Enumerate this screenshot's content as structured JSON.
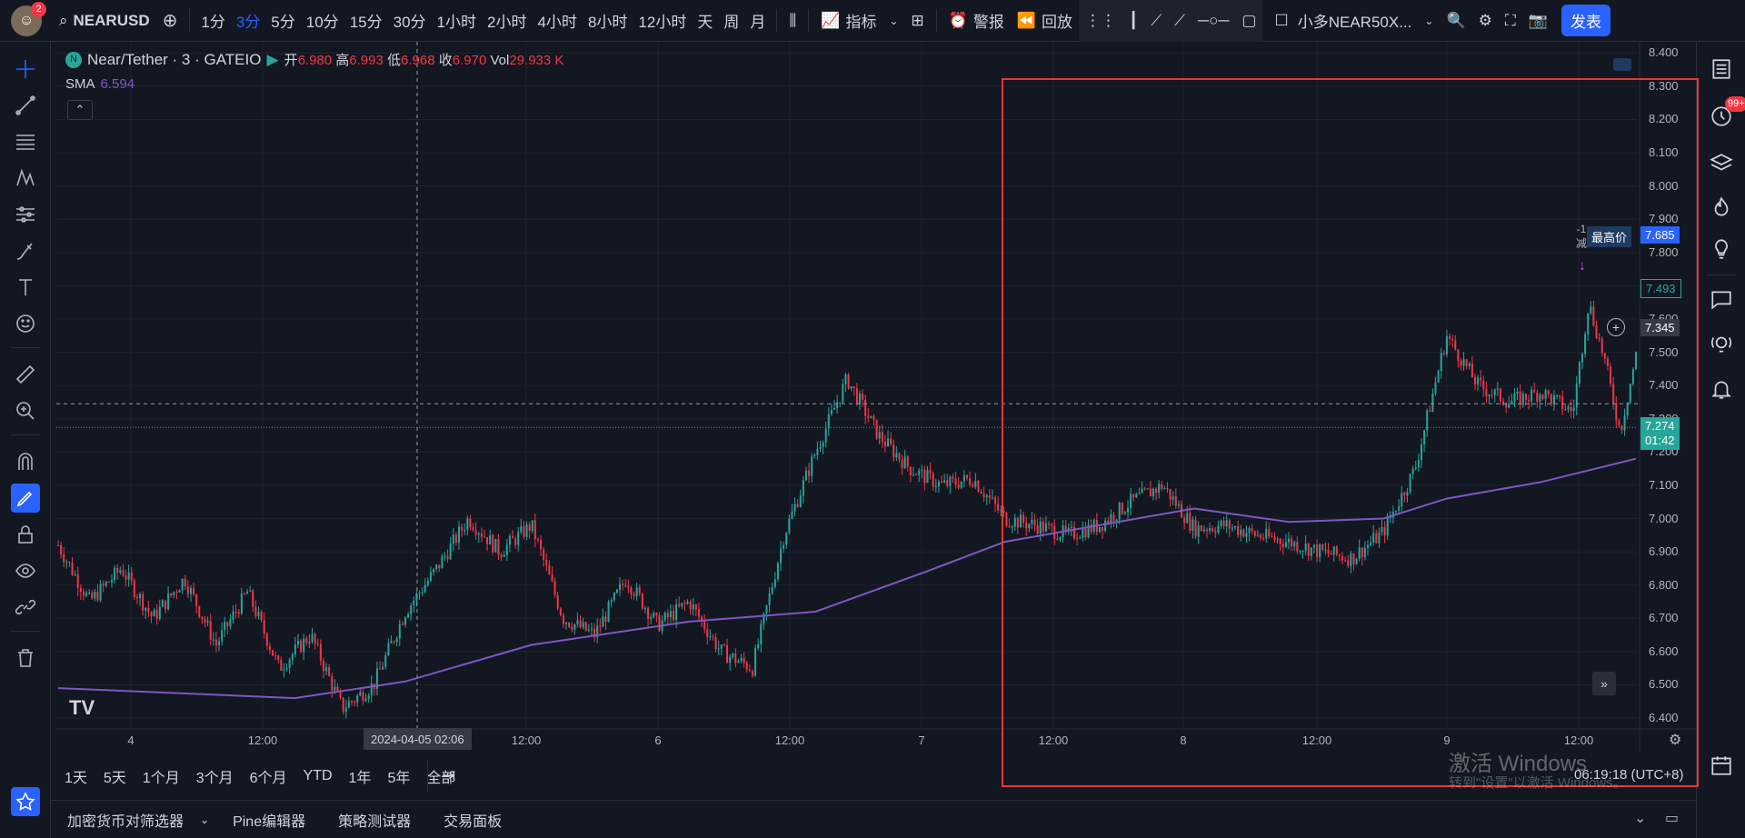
{
  "topbar": {
    "notification_count": "2",
    "symbol": "NEARUSD",
    "intervals": [
      "1分",
      "3分",
      "5分",
      "10分",
      "15分",
      "30分",
      "1小时",
      "2小时",
      "4小时",
      "8小时",
      "12小时",
      "天",
      "周",
      "月"
    ],
    "active_interval": "3分",
    "indicators_label": "指标",
    "alert_label": "警报",
    "replay_label": "回放",
    "layout_name": "小多NEAR50X...",
    "publish_label": "发表"
  },
  "legend": {
    "title": "Near/Tether · 3 · GATEIO",
    "open_label": "开",
    "open": "6.980",
    "high_label": "高",
    "high": "6.993",
    "low_label": "低",
    "low": "6.968",
    "close_label": "收",
    "close": "6.970",
    "vol_label": "Vol",
    "vol": "29.933 K",
    "sma_label": "SMA",
    "sma_value": "6.594"
  },
  "chart_data": {
    "type": "candlestick",
    "price_axis": [
      "8.400",
      "8.300",
      "8.200",
      "8.100",
      "8.000",
      "7.900",
      "7.800",
      "7.700",
      "7.600",
      "7.500",
      "7.400",
      "7.300",
      "7.200",
      "7.100",
      "7.000",
      "6.900",
      "6.800",
      "6.700",
      "6.600",
      "6.500",
      "6.400"
    ],
    "time_axis": [
      "4",
      "12:00",
      "12:00",
      "6",
      "12:00",
      "7",
      "12:00",
      "8",
      "12:00",
      "9",
      "12:00"
    ],
    "crosshair_time": "2024-04-05   02:06",
    "ylim": [
      6.37,
      8.42
    ],
    "price_path": [
      [
        0,
        6.92
      ],
      [
        0.02,
        6.75
      ],
      [
        0.04,
        6.85
      ],
      [
        0.06,
        6.7
      ],
      [
        0.08,
        6.82
      ],
      [
        0.1,
        6.62
      ],
      [
        0.12,
        6.78
      ],
      [
        0.14,
        6.55
      ],
      [
        0.16,
        6.65
      ],
      [
        0.18,
        6.43
      ],
      [
        0.2,
        6.5
      ],
      [
        0.22,
        6.72
      ],
      [
        0.24,
        6.85
      ],
      [
        0.26,
        7.0
      ],
      [
        0.28,
        6.9
      ],
      [
        0.3,
        6.98
      ],
      [
        0.32,
        6.7
      ],
      [
        0.34,
        6.65
      ],
      [
        0.36,
        6.82
      ],
      [
        0.38,
        6.68
      ],
      [
        0.4,
        6.75
      ],
      [
        0.42,
        6.6
      ],
      [
        0.44,
        6.55
      ],
      [
        0.46,
        6.95
      ],
      [
        0.48,
        7.2
      ],
      [
        0.5,
        7.42
      ],
      [
        0.52,
        7.25
      ],
      [
        0.54,
        7.15
      ],
      [
        0.56,
        7.1
      ],
      [
        0.58,
        7.12
      ],
      [
        0.6,
        7.0
      ],
      [
        0.62,
        6.98
      ],
      [
        0.64,
        6.95
      ],
      [
        0.66,
        6.98
      ],
      [
        0.68,
        7.05
      ],
      [
        0.7,
        7.1
      ],
      [
        0.72,
        6.97
      ],
      [
        0.74,
        6.98
      ],
      [
        0.76,
        6.95
      ],
      [
        0.78,
        6.93
      ],
      [
        0.8,
        6.9
      ],
      [
        0.82,
        6.88
      ],
      [
        0.84,
        6.96
      ],
      [
        0.86,
        7.15
      ],
      [
        0.88,
        7.55
      ],
      [
        0.9,
        7.4
      ],
      [
        0.92,
        7.35
      ],
      [
        0.94,
        7.38
      ],
      [
        0.96,
        7.32
      ],
      [
        0.97,
        7.65
      ],
      [
        0.98,
        7.48
      ],
      [
        0.99,
        7.26
      ],
      [
        1.0,
        7.49
      ]
    ],
    "sma_path": [
      [
        0,
        6.49
      ],
      [
        0.1,
        6.47
      ],
      [
        0.15,
        6.46
      ],
      [
        0.22,
        6.51
      ],
      [
        0.3,
        6.62
      ],
      [
        0.4,
        6.69
      ],
      [
        0.48,
        6.72
      ],
      [
        0.55,
        6.84
      ],
      [
        0.6,
        6.93
      ],
      [
        0.66,
        6.98
      ],
      [
        0.72,
        7.03
      ],
      [
        0.78,
        6.99
      ],
      [
        0.84,
        7.0
      ],
      [
        0.88,
        7.06
      ],
      [
        0.94,
        7.11
      ],
      [
        1.0,
        7.18
      ]
    ],
    "highest_price_label": "最高价",
    "highest_price": "7.685",
    "last_price_a": "7.493",
    "crosshair_price": "7.345",
    "current_price": "7.274",
    "countdown": "01:42",
    "marker_text": "-1",
    "marker_sub": "减"
  },
  "timeframes": [
    "1天",
    "5天",
    "1个月",
    "3个月",
    "6个月",
    "YTD",
    "1年",
    "5年",
    "全部"
  ],
  "clock": "06:19:18 (UTC+8)",
  "bottom_tabs": [
    "加密货币对筛选器",
    "Pine编辑器",
    "策略测试器",
    "交易面板"
  ],
  "right_badge": "99+",
  "watermark": "激活 Windows",
  "watermark_sub": "转到\"设置\"以激活 Windows。",
  "colors": {
    "up": "#26a69a",
    "down": "#f23645",
    "sma": "#7e57c2",
    "accent": "#2962ff"
  }
}
